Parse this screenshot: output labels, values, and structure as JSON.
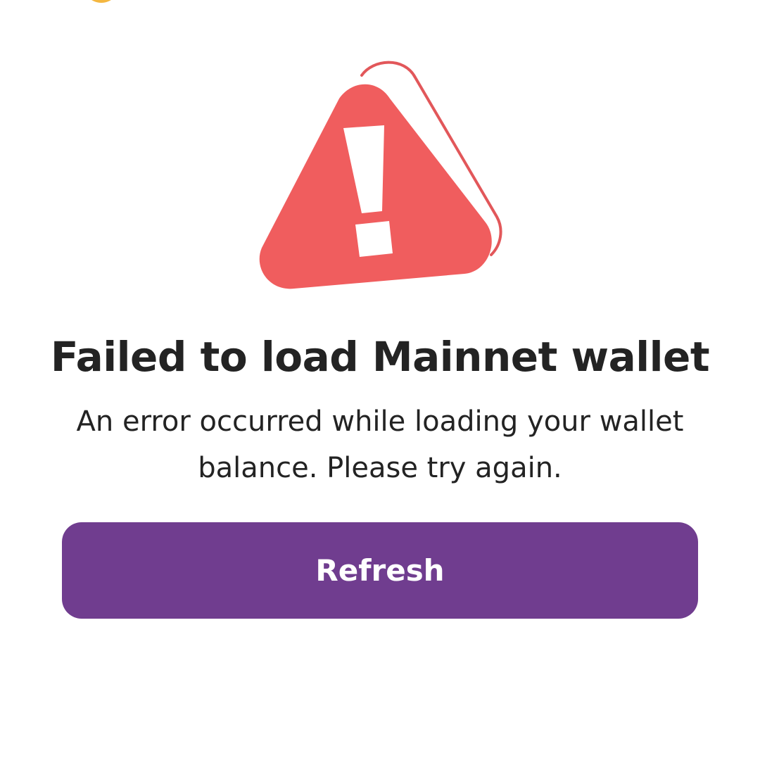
{
  "error": {
    "title": "Failed to load Mainnet wallet",
    "message": "An error occurred while loading your wallet balance. Please try again.",
    "icon": "warning-triangle-icon"
  },
  "actions": {
    "refresh_label": "Refresh"
  },
  "colors": {
    "accent": "#703d8f",
    "warning": "#f05d5e",
    "text": "#232323",
    "avatar": "#f4b740"
  }
}
